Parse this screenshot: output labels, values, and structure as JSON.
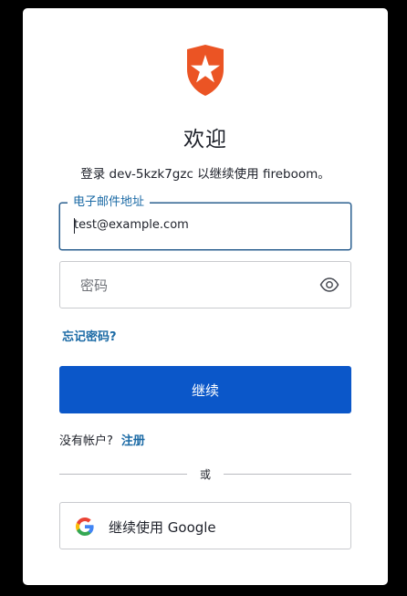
{
  "header": {
    "title": "欢迎",
    "subtitle": "登录 dev-5kzk7gzc 以继续使用 fireboom。"
  },
  "brand": {
    "logo_icon": "auth0-shield-star-icon",
    "logo_color": "#eb5424"
  },
  "form": {
    "email": {
      "label": "电子邮件地址",
      "value": "test@example.com"
    },
    "password": {
      "placeholder": "密码",
      "toggle_icon": "eye-icon"
    },
    "forgot_password": "忘记密码?",
    "submit_label": "继续"
  },
  "signup": {
    "prompt": "没有帐户?",
    "link": "注册"
  },
  "divider": {
    "text": "或"
  },
  "social": {
    "google_label": "继续使用 Google",
    "google_icon": "google-icon"
  },
  "colors": {
    "primary_button": "#0b57c9",
    "link": "#1b6aa5",
    "focus_border": "#2a5f8f"
  }
}
